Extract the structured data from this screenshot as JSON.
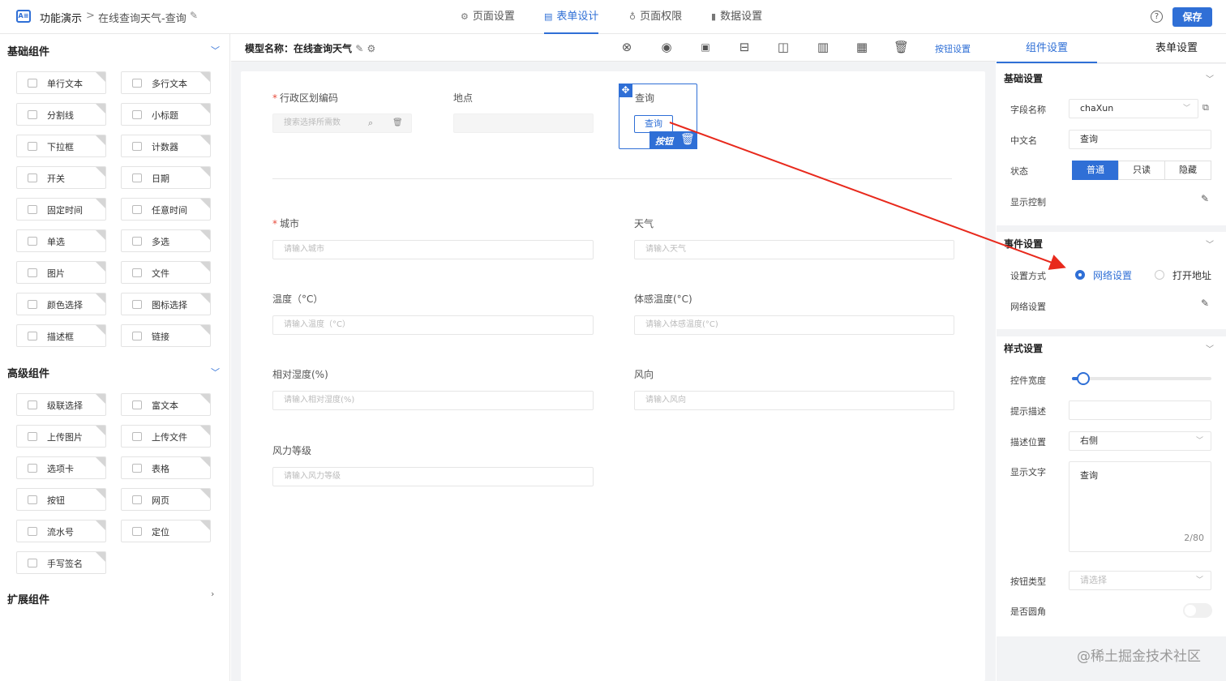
{
  "header": {
    "logo_text": "A≡",
    "breadcrumb_root": "功能演示",
    "breadcrumb_sep": ">",
    "breadcrumb_page": "在线查询天气-查询",
    "nav": [
      {
        "label": "页面设置",
        "icon": "gear-icon",
        "glyph": "⚙",
        "active": false
      },
      {
        "label": "表单设计",
        "icon": "form-icon",
        "glyph": "▤",
        "active": true
      },
      {
        "label": "页面权限",
        "icon": "lock-icon",
        "glyph": "♁",
        "active": false
      },
      {
        "label": "数据设置",
        "icon": "bar-chart-icon",
        "glyph": "▮",
        "active": false
      }
    ],
    "help": "?",
    "save_label": "保存"
  },
  "left_panel": {
    "basic_title": "基础组件",
    "basic_items": [
      "单行文本",
      "多行文本",
      "分割线",
      "小标题",
      "下拉框",
      "计数器",
      "开关",
      "日期",
      "固定时间",
      "任意时间",
      "单选",
      "多选",
      "图片",
      "文件",
      "颜色选择",
      "图标选择",
      "描述框",
      "链接"
    ],
    "advanced_title": "高级组件",
    "advanced_items": [
      "级联选择",
      "富文本",
      "上传图片",
      "上传文件",
      "选项卡",
      "表格",
      "按钮",
      "网页",
      "流水号",
      "定位",
      "手写签名"
    ],
    "extension_title": "扩展组件"
  },
  "canvas_toolbar": {
    "model_name": "模型名称：在线查询天气",
    "button_settings": "按钮设置"
  },
  "form": {
    "fields": [
      {
        "label": "行政区划编码",
        "required": true,
        "placeholder": "搜索选择所需数"
      },
      {
        "label": "地点",
        "required": false,
        "placeholder": ""
      },
      {
        "label": "城市",
        "required": true,
        "placeholder": "请输入城市"
      },
      {
        "label": "天气",
        "required": false,
        "placeholder": "请输入天气"
      },
      {
        "label": "温度（°C）",
        "required": false,
        "placeholder": "请输入温度（°C）"
      },
      {
        "label": "体感温度(°C)",
        "required": false,
        "placeholder": "请输入体感温度(°C)"
      },
      {
        "label": "相对湿度(%)",
        "required": false,
        "placeholder": "请输入相对湿度(%)"
      },
      {
        "label": "风向",
        "required": false,
        "placeholder": "请输入风向"
      },
      {
        "label": "风力等级",
        "required": false,
        "placeholder": "请输入风力等级"
      }
    ],
    "selected": {
      "label": "查询",
      "button_text": "查询",
      "tag": "按钮"
    }
  },
  "right_panel": {
    "tabs": [
      "组件设置",
      "表单设置"
    ],
    "basic": {
      "title": "基础设置",
      "field_name_label": "字段名称",
      "field_name_value": "chaXun",
      "cn_name_label": "中文名",
      "cn_name_value": "查询",
      "status_label": "状态",
      "status_options": [
        "普通",
        "只读",
        "隐藏"
      ],
      "display_control_label": "显示控制"
    },
    "event": {
      "title": "事件设置",
      "mode_label": "设置方式",
      "mode_options": [
        "网络设置",
        "打开地址"
      ],
      "network_label": "网络设置"
    },
    "style": {
      "title": "样式设置",
      "width_label": "控件宽度",
      "width_value": 0.08,
      "hint_label": "提示描述",
      "hint_pos_label": "描述位置",
      "hint_pos_value": "右侧",
      "display_text_label": "显示文字",
      "display_text_value": "查询",
      "display_text_count": "2/80",
      "button_type_label": "按钮类型",
      "button_type_placeholder": "请选择",
      "rounded_label": "是否圆角",
      "rounded_on": false
    }
  },
  "watermark": "@稀土掘金技术社区",
  "colors": {
    "accent": "#2f6fd6",
    "arrow": "#e8291c",
    "required": "#e74c3c"
  }
}
